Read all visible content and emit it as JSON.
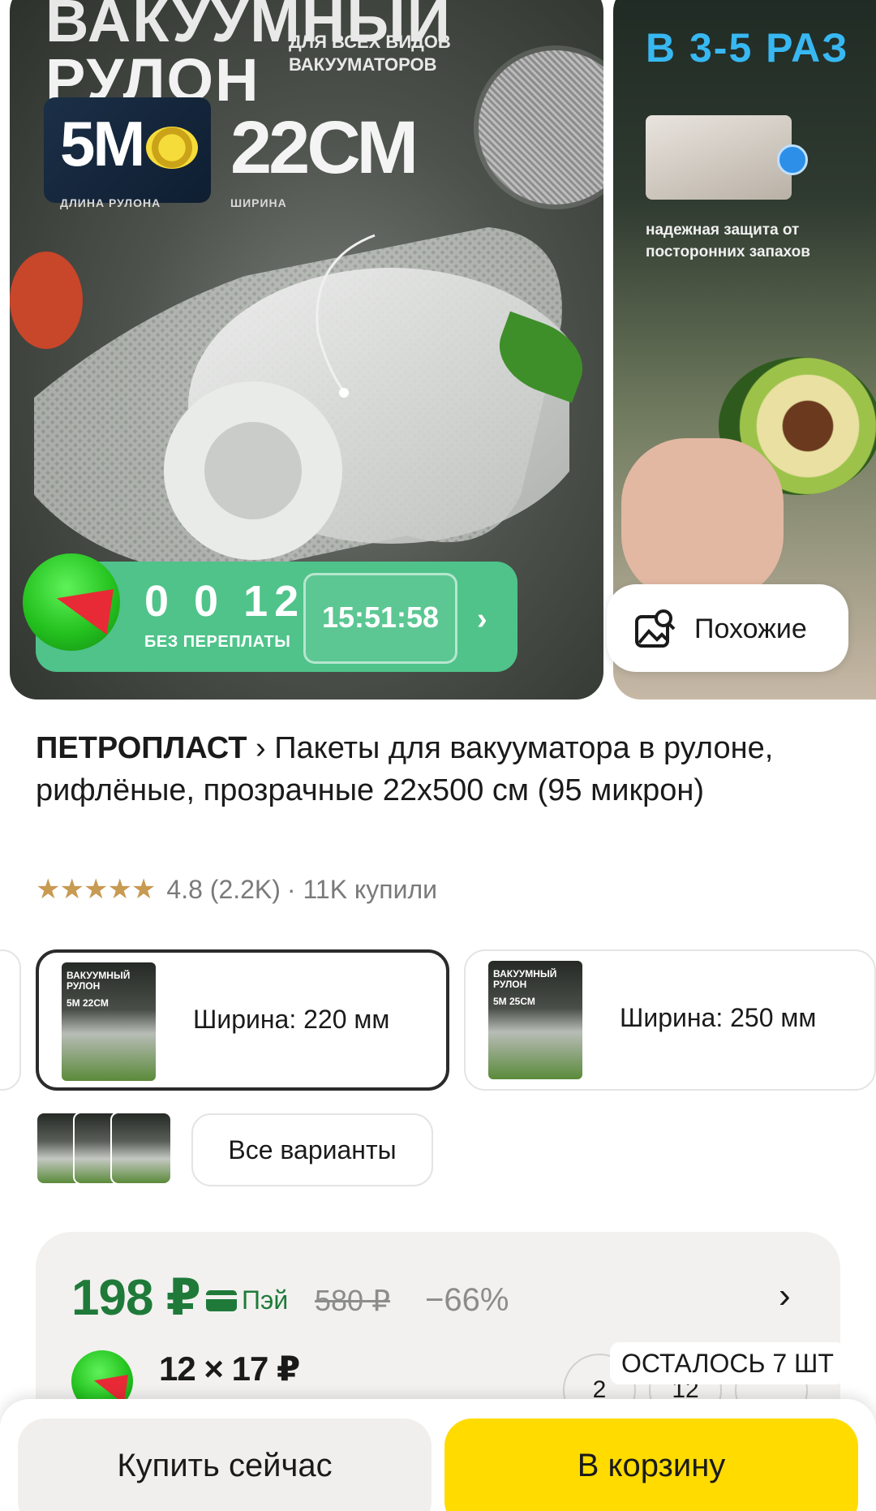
{
  "gallery": {
    "slide1": {
      "title_line1": "ВАКУУМНЫЙ",
      "title_line2": "РУЛОН",
      "subtitle_line1": "ДЛЯ ВСЕХ ВИДОВ",
      "subtitle_line2": "ВАКУУМАТОРОВ",
      "length_value": "5М",
      "length_caption": "ДЛИНА РУЛОНА",
      "width_value": "22СМ",
      "width_caption": "ШИРИНА"
    },
    "slide2": {
      "title": "В 3-5 РАЗ",
      "text": "надежная защита от посторонних запахов"
    },
    "promo": {
      "counter": "0 0 12",
      "caption": "БЕЗ ПЕРЕПЛАТЫ",
      "timer": "15:51:58"
    },
    "similar_label": "Похожие"
  },
  "product": {
    "brand": "ПЕТРОПЛАСТ",
    "title": "Пакеты для вакууматора в рулоне, рифлёные, прозрачные 22х500 см (95 микрон)",
    "stars": "★★★★★",
    "rating": "4.8 (2.2K)",
    "bought": "· 11K купили"
  },
  "variants": {
    "items": [
      {
        "label": "Ширина: 220 мм",
        "thumb_title": "ВАКУУМНЫЙ РУЛОН",
        "thumb_size": "5М 22СМ",
        "selected": true
      },
      {
        "label": "Ширина: 250 мм",
        "thumb_title": "ВАКУУМНЫЙ РУЛОН",
        "thumb_size": "5М 25СМ",
        "selected": false
      }
    ],
    "all_label": "Все варианты"
  },
  "price": {
    "current": "198 ₽",
    "pay_label": "Пэй",
    "old": "580 ₽",
    "discount": "−66%",
    "installment": "12 × 17 ₽",
    "quantity_options": [
      "2",
      "12"
    ],
    "stock": "ОСТАЛОСЬ 7 ШТ"
  },
  "actions": {
    "buy_now": "Купить сейчас",
    "add_to_cart": "В корзину"
  },
  "colors": {
    "accent_green": "#1f7a3a",
    "cart_yellow": "#ffdb00",
    "promo_green": "#4fc38a"
  }
}
